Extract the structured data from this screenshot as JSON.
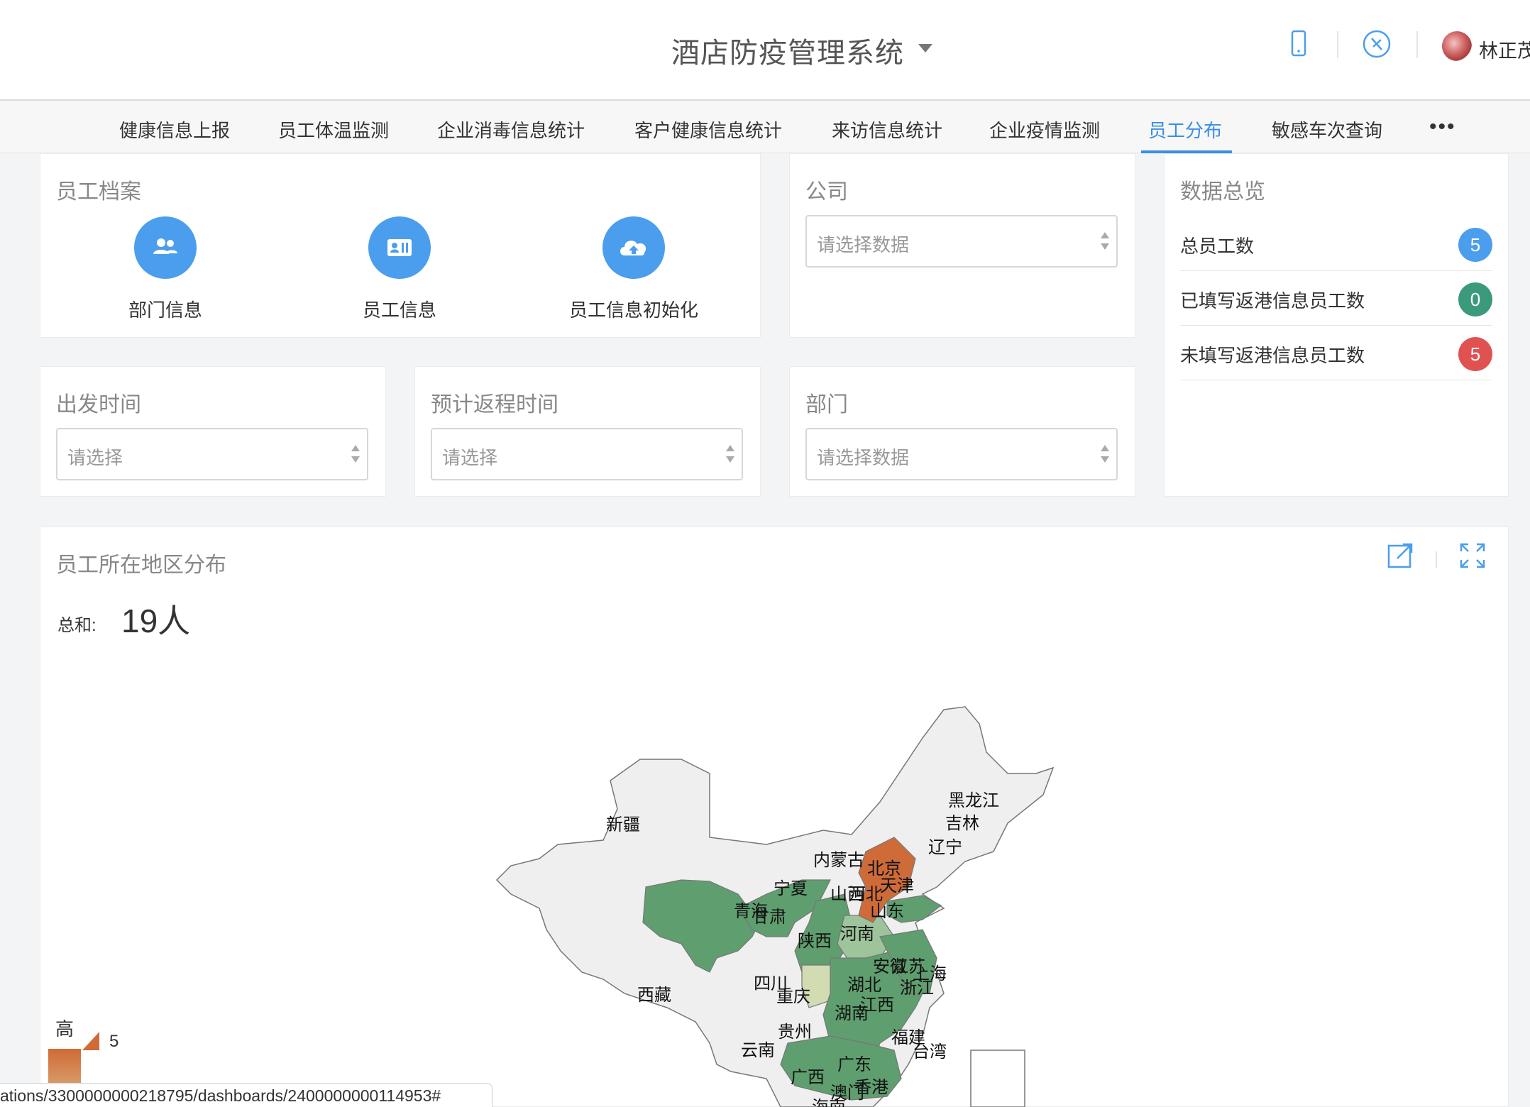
{
  "header": {
    "title": "酒店防疫管理系统",
    "user_name": "林正茂",
    "icons": [
      "mobile-icon",
      "compass-icon"
    ]
  },
  "nav": {
    "items": [
      {
        "label": "健康信息上报"
      },
      {
        "label": "员工体温监测"
      },
      {
        "label": "企业消毒信息统计"
      },
      {
        "label": "客户健康信息统计"
      },
      {
        "label": "来访信息统计"
      },
      {
        "label": "企业疫情监测"
      },
      {
        "label": "员工分布",
        "active": true
      },
      {
        "label": "敏感车次查询"
      }
    ],
    "more": "•••",
    "accent": "#3a8ee6"
  },
  "archive": {
    "title": "员工档案",
    "buttons": [
      {
        "label": "部门信息",
        "icon": "group-icon"
      },
      {
        "label": "员工信息",
        "icon": "id-card-icon"
      },
      {
        "label": "员工信息初始化",
        "icon": "cloud-upload-icon"
      }
    ]
  },
  "company": {
    "title": "公司",
    "placeholder": "请选择数据"
  },
  "depart_time": {
    "title": "出发时间",
    "placeholder": "请选择"
  },
  "return_time": {
    "title": "预计返程时间",
    "placeholder": "请选择"
  },
  "department": {
    "title": "部门",
    "placeholder": "请选择数据"
  },
  "overview": {
    "title": "数据总览",
    "rows": [
      {
        "label": "总员工数",
        "value": "5",
        "color": "#4a9eed"
      },
      {
        "label": "已填写返港信息员工数",
        "value": "0",
        "color": "#3c9a7c"
      },
      {
        "label": "未填写返港信息员工数",
        "value": "5",
        "color": "#e05252"
      }
    ]
  },
  "map": {
    "title": "员工所在地区分布",
    "sum_label": "总和:",
    "sum_value": "19人",
    "legend_high": "高",
    "legend_max": "5",
    "provinces": [
      "新疆",
      "西藏",
      "青海",
      "甘肃",
      "宁夏",
      "内蒙古",
      "黑龙江",
      "吉林",
      "辽宁",
      "北京",
      "天津",
      "河北",
      "山西",
      "山东",
      "陕西",
      "河南",
      "四川",
      "重庆",
      "湖北",
      "安徽",
      "江苏",
      "上海",
      "浙江",
      "湖南",
      "江西",
      "贵州",
      "云南",
      "广西",
      "广东",
      "福建",
      "台湾",
      "香港",
      "澳门",
      "海南"
    ]
  },
  "status_bar": {
    "url": "ations/3300000000218795/dashboards/2400000000114953#"
  }
}
